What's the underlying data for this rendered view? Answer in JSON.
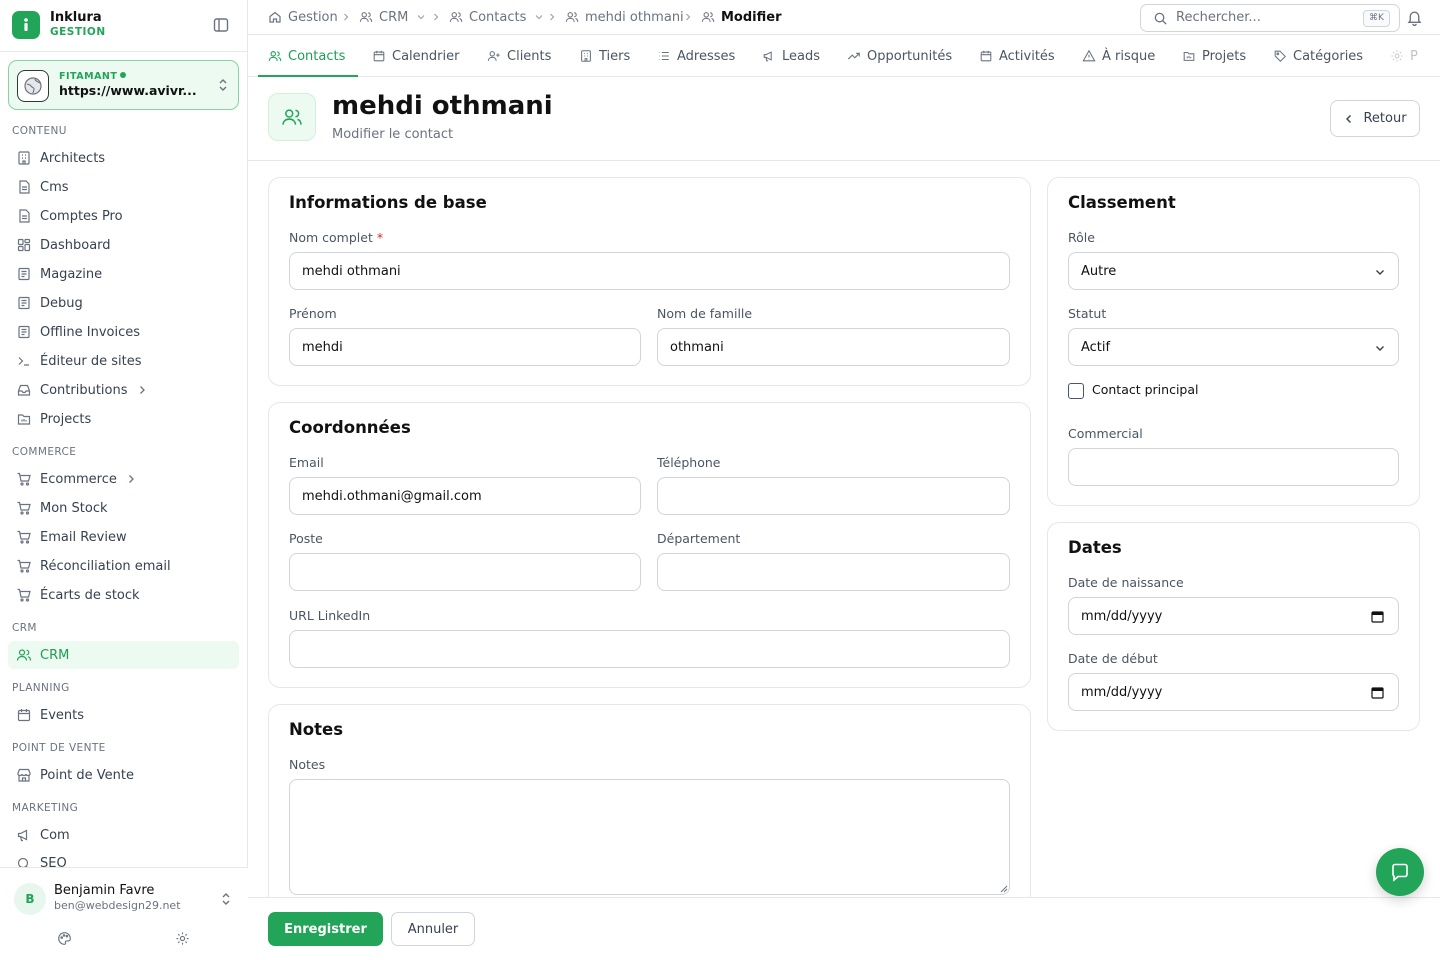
{
  "app": {
    "name": "Inklura",
    "subtitle": "GESTION"
  },
  "site": {
    "label": "FITAMANT",
    "url": "https://www.avivr..."
  },
  "sidebar": {
    "sections": {
      "contenu": "CONTENU",
      "commerce": "COMMERCE",
      "crm": "CRM",
      "planning": "PLANNING",
      "pos": "POINT DE VENTE",
      "marketing": "MARKETING"
    },
    "items": {
      "architects": "Architects",
      "cms": "Cms",
      "comptes_pro": "Comptes Pro",
      "dashboard": "Dashboard",
      "magazine": "Magazine",
      "debug": "Debug",
      "offline_invoices": "Offline Invoices",
      "editeur": "Éditeur de sites",
      "contributions": "Contributions",
      "projects": "Projects",
      "ecommerce": "Ecommerce",
      "mon_stock": "Mon Stock",
      "email_review": "Email Review",
      "reconciliation": "Réconciliation email",
      "ecarts": "Écarts de stock",
      "crm": "CRM",
      "events": "Events",
      "point_de_vente": "Point de Vente",
      "com": "Com",
      "seo": "SEO"
    }
  },
  "user": {
    "initial": "B",
    "name": "Benjamin Favre",
    "email": "ben@webdesign29.net"
  },
  "breadcrumb": {
    "gestion": "Gestion",
    "crm": "CRM",
    "contacts": "Contacts",
    "contact": "mehdi othmani",
    "current": "Modifier"
  },
  "search": {
    "placeholder": "Rechercher...",
    "shortcut": "⌘K"
  },
  "tabs": {
    "contacts": "Contacts",
    "calendrier": "Calendrier",
    "clients": "Clients",
    "tiers": "Tiers",
    "adresses": "Adresses",
    "leads": "Leads",
    "opportunites": "Opportunités",
    "activites": "Activités",
    "a_risque": "À risque",
    "projets": "Projets",
    "categories": "Catégories",
    "more": "P"
  },
  "header": {
    "title": "mehdi othmani",
    "subtitle": "Modifier le contact",
    "back_label": "Retour"
  },
  "basic_info": {
    "title": "Informations de base",
    "full_name_label": "Nom complet",
    "full_name_required": "*",
    "full_name_value": "mehdi othmani",
    "first_name_label": "Prénom",
    "first_name_value": "mehdi",
    "last_name_label": "Nom de famille",
    "last_name_value": "othmani"
  },
  "contact_info": {
    "title": "Coordonnées",
    "email_label": "Email",
    "email_value": "mehdi.othmani@gmail.com",
    "phone_label": "Téléphone",
    "phone_value": "",
    "position_label": "Poste",
    "position_value": "",
    "department_label": "Département",
    "department_value": "",
    "linkedin_label": "URL LinkedIn",
    "linkedin_value": ""
  },
  "notes": {
    "title": "Notes",
    "label": "Notes",
    "value": ""
  },
  "classification": {
    "title": "Classement",
    "role_label": "Rôle",
    "role_value": "Autre",
    "status_label": "Statut",
    "status_value": "Actif",
    "primary_contact_label": "Contact principal",
    "primary_contact_checked": false,
    "commercial_label": "Commercial",
    "commercial_value": ""
  },
  "dates": {
    "title": "Dates",
    "birth_label": "Date de naissance",
    "birth_placeholder": "mm/dd/yyyy",
    "start_label": "Date de début",
    "start_placeholder": "mm/dd/yyyy"
  },
  "actions": {
    "save": "Enregistrer",
    "cancel": "Annuler"
  },
  "colors": {
    "accent": "#22a558",
    "accent_light": "#ecfaf1",
    "required": "#dc2626"
  }
}
